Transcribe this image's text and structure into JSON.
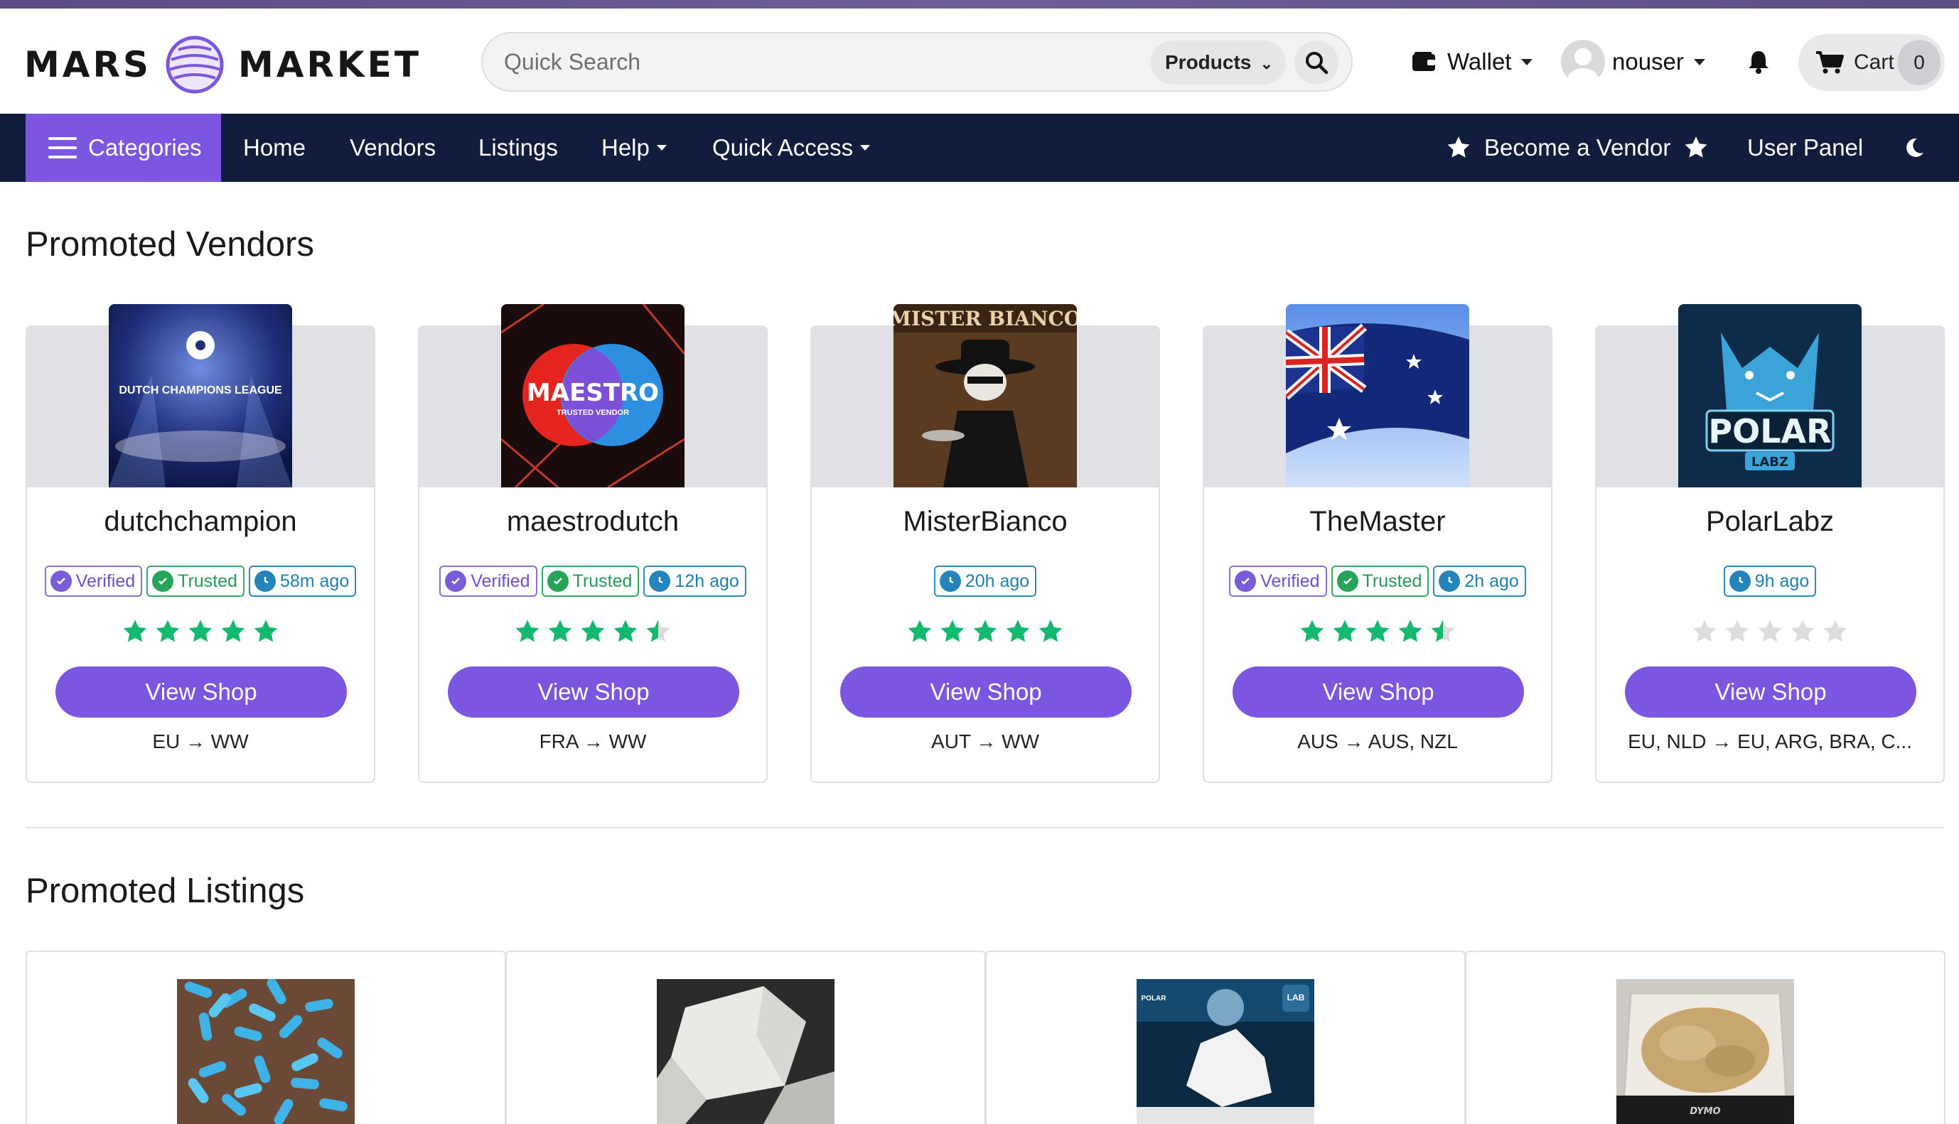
{
  "brand": {
    "left": "MARS",
    "right": "MARKET"
  },
  "search": {
    "placeholder": "Quick Search",
    "category": "Products"
  },
  "header": {
    "wallet": "Wallet",
    "user": "nouser",
    "cart_label": "Cart",
    "cart_count": "0"
  },
  "nav": {
    "categories": "Categories",
    "links": [
      "Home",
      "Vendors",
      "Listings",
      "Help",
      "Quick Access"
    ],
    "become_vendor": "Become a Vendor",
    "user_panel": "User Panel"
  },
  "promoted_vendors": {
    "title": "Promoted Vendors",
    "button_label": "View Shop",
    "vendors": [
      {
        "name": "dutchchampion",
        "badges": [
          "Verified",
          "Trusted",
          "58m ago"
        ],
        "rating": 5,
        "shipping": "EU → WW",
        "image_text": [
          "DUTCH CHAMPIONS LEAGUE"
        ]
      },
      {
        "name": "maestrodutch",
        "badges": [
          "Verified",
          "Trusted",
          "12h ago"
        ],
        "rating": 4.5,
        "shipping": "FRA → WW",
        "image_text": [
          "MAESTRO",
          "TRUSTED VENDOR"
        ]
      },
      {
        "name": "MisterBianco",
        "badges": [
          "20h ago"
        ],
        "rating": 5,
        "shipping": "AUT → WW",
        "image_text": [
          "MISTER BIANCO"
        ]
      },
      {
        "name": "TheMaster",
        "badges": [
          "Verified",
          "Trusted",
          "2h ago"
        ],
        "rating": 4.5,
        "shipping": "AUS → AUS, NZL",
        "image_text": []
      },
      {
        "name": "PolarLabz",
        "badges": [
          "9h ago"
        ],
        "rating": 0,
        "shipping": "EU, NLD → EU, ARG, BRA, C...",
        "image_text": [
          "POLAR",
          "LABZ"
        ]
      }
    ]
  },
  "promoted_listings": {
    "title": "Promoted Listings",
    "listings": [
      {
        "image": "blue-pills-photo",
        "image_text": []
      },
      {
        "image": "white-crystal-photo",
        "image_text": []
      },
      {
        "image": "crystal-astronaut-photo",
        "image_text": [
          "POLAR",
          "LAB"
        ]
      },
      {
        "image": "tan-powder-bag-photo",
        "image_text": [
          "DYMO"
        ]
      }
    ]
  },
  "icons": [
    "planet-logo-icon",
    "search-icon",
    "wallet-icon",
    "user-avatar-icon",
    "bell-icon",
    "cart-icon",
    "hamburger-icon",
    "star-icon",
    "moon-icon",
    "verified-icon",
    "trusted-shield-icon",
    "clock-icon"
  ],
  "colors": {
    "accent": "#7c55e0",
    "navbar": "#121c3d",
    "star": "#14b86e",
    "star_empty": "#dcdcdf",
    "verified": "#7a5bd8",
    "trusted": "#28a35a",
    "time": "#2585bb"
  }
}
